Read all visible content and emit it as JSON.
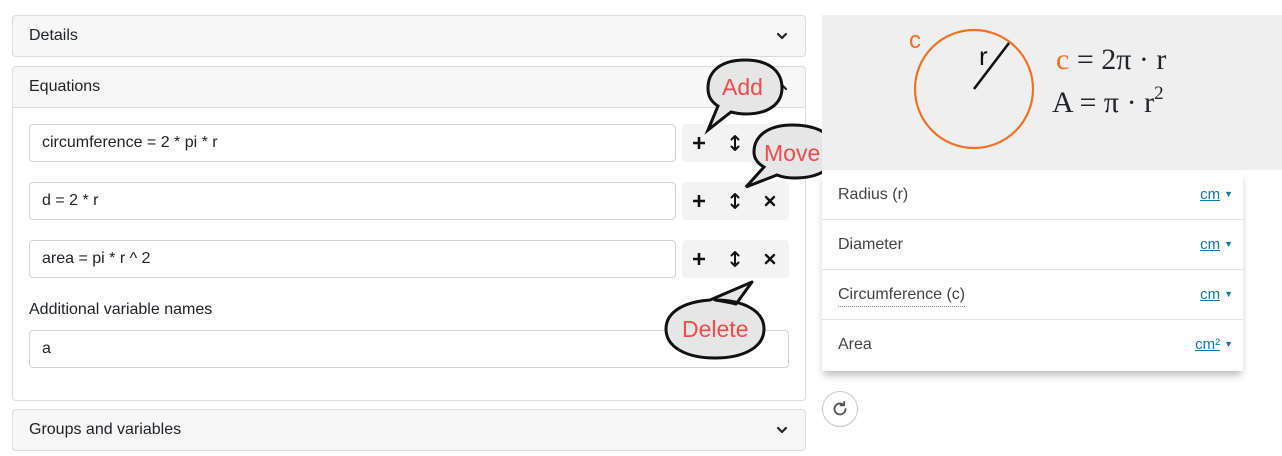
{
  "panels": {
    "details_title": "Details",
    "equations_title": "Equations",
    "groups_title": "Groups and variables"
  },
  "equations": [
    "circumference = 2 * pi * r",
    "d = 2 * r",
    "area = pi * r ^ 2"
  ],
  "additional": {
    "label": "Additional variable names",
    "value": "a"
  },
  "callouts": {
    "add": "Add",
    "move": "Move",
    "delete": "Delete"
  },
  "diagram": {
    "circle_label": "c",
    "radius_label": "r",
    "formula1_var": "c",
    "formula1_rest": "= 2π · r",
    "formula2": "A = π · r",
    "formula2_exp": "2"
  },
  "variables": [
    {
      "name": "Radius (r)",
      "unit": "cm"
    },
    {
      "name": "Diameter",
      "unit": "cm"
    },
    {
      "name": "Circumference (c)",
      "unit": "cm"
    },
    {
      "name": "Area",
      "unit": "cm²"
    }
  ],
  "icons": {
    "add": "plus-icon",
    "move": "move-vertical-icon",
    "delete": "close-icon",
    "chevron": "chevron-icon",
    "reset": "refresh-icon"
  },
  "colors": {
    "accent_orange": "#f36f21",
    "callout_red": "#ef4b4b",
    "link_blue": "#1178a8"
  }
}
